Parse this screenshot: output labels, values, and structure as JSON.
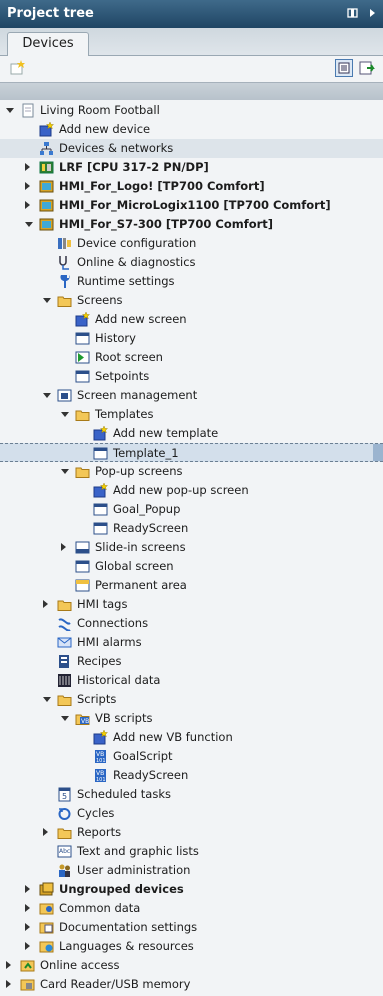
{
  "header": {
    "title": "Project tree"
  },
  "tabs": [
    {
      "label": "Devices"
    }
  ],
  "icons": {
    "pin": "pin-icon",
    "close": "close-arrow-icon",
    "new_group": "new-group-icon",
    "detail_view": "detail-view-icon",
    "export": "export-icon"
  },
  "tree": [
    {
      "label": "Living Room Football",
      "level": 0,
      "expander": "open",
      "icon": "project-icon"
    },
    {
      "label": "Add new device",
      "level": 1,
      "expander": "none",
      "icon": "add-device-icon"
    },
    {
      "label": "Devices & networks",
      "level": 1,
      "expander": "none",
      "icon": "network-icon",
      "highlight": true
    },
    {
      "label": "LRF [CPU 317-2 PN/DP]",
      "level": 1,
      "expander": "closed",
      "icon": "plc-icon",
      "bold": true
    },
    {
      "label": "HMI_For_Logo! [TP700 Comfort]",
      "level": 1,
      "expander": "closed",
      "icon": "hmi-device-icon",
      "bold": true
    },
    {
      "label": "HMI_For_MicroLogix1100 [TP700 Comfort]",
      "level": 1,
      "expander": "closed",
      "icon": "hmi-device-icon",
      "bold": true
    },
    {
      "label": "HMI_For_S7-300 [TP700 Comfort]",
      "level": 1,
      "expander": "open",
      "icon": "hmi-device-icon",
      "bold": true
    },
    {
      "label": "Device configuration",
      "level": 2,
      "expander": "none",
      "icon": "device-config-icon"
    },
    {
      "label": "Online & diagnostics",
      "level": 2,
      "expander": "none",
      "icon": "diagnostics-icon"
    },
    {
      "label": "Runtime settings",
      "level": 2,
      "expander": "none",
      "icon": "wrench-icon"
    },
    {
      "label": "Screens",
      "level": 2,
      "expander": "open",
      "icon": "folder-icon"
    },
    {
      "label": "Add new screen",
      "level": 3,
      "expander": "none",
      "icon": "add-screen-icon"
    },
    {
      "label": "History",
      "level": 3,
      "expander": "none",
      "icon": "screen-icon"
    },
    {
      "label": "Root screen",
      "level": 3,
      "expander": "none",
      "icon": "root-screen-icon"
    },
    {
      "label": "Setpoints",
      "level": 3,
      "expander": "none",
      "icon": "screen-icon"
    },
    {
      "label": "Screen management",
      "level": 2,
      "expander": "open",
      "icon": "screen-management-icon"
    },
    {
      "label": "Templates",
      "level": 3,
      "expander": "open",
      "icon": "template-folder-icon"
    },
    {
      "label": "Add new template",
      "level": 4,
      "expander": "none",
      "icon": "add-screen-icon"
    },
    {
      "label": "Template_1",
      "level": 4,
      "expander": "none",
      "icon": "screen-icon",
      "selected": true
    },
    {
      "label": "Pop-up screens",
      "level": 3,
      "expander": "open",
      "icon": "folder-icon"
    },
    {
      "label": "Add new pop-up screen",
      "level": 4,
      "expander": "none",
      "icon": "add-screen-icon"
    },
    {
      "label": "Goal_Popup",
      "level": 4,
      "expander": "none",
      "icon": "screen-icon"
    },
    {
      "label": "ReadyScreen",
      "level": 4,
      "expander": "none",
      "icon": "screen-icon"
    },
    {
      "label": "Slide-in screens",
      "level": 3,
      "expander": "closed",
      "icon": "slide-in-icon"
    },
    {
      "label": "Global screen",
      "level": 3,
      "expander": "none",
      "icon": "global-screen-icon"
    },
    {
      "label": "Permanent area",
      "level": 3,
      "expander": "none",
      "icon": "permanent-area-icon"
    },
    {
      "label": "HMI tags",
      "level": 2,
      "expander": "closed",
      "icon": "tags-folder-icon"
    },
    {
      "label": "Connections",
      "level": 2,
      "expander": "none",
      "icon": "connections-icon"
    },
    {
      "label": "HMI alarms",
      "level": 2,
      "expander": "none",
      "icon": "alarms-icon"
    },
    {
      "label": "Recipes",
      "level": 2,
      "expander": "none",
      "icon": "recipes-icon"
    },
    {
      "label": "Historical data",
      "level": 2,
      "expander": "none",
      "icon": "historical-data-icon"
    },
    {
      "label": "Scripts",
      "level": 2,
      "expander": "open",
      "icon": "scripts-folder-icon"
    },
    {
      "label": "VB scripts",
      "level": 3,
      "expander": "open",
      "icon": "vb-folder-icon"
    },
    {
      "label": "Add new VB function",
      "level": 4,
      "expander": "none",
      "icon": "add-screen-icon"
    },
    {
      "label": "GoalScript",
      "level": 4,
      "expander": "none",
      "icon": "vb-script-icon"
    },
    {
      "label": "ReadyScreen",
      "level": 4,
      "expander": "none",
      "icon": "vb-script-icon"
    },
    {
      "label": "Scheduled tasks",
      "level": 2,
      "expander": "none",
      "icon": "calendar-icon"
    },
    {
      "label": "Cycles",
      "level": 2,
      "expander": "none",
      "icon": "cycles-icon"
    },
    {
      "label": "Reports",
      "level": 2,
      "expander": "closed",
      "icon": "reports-icon"
    },
    {
      "label": "Text and graphic lists",
      "level": 2,
      "expander": "none",
      "icon": "text-lists-icon"
    },
    {
      "label": "User administration",
      "level": 2,
      "expander": "none",
      "icon": "users-icon"
    },
    {
      "label": "Ungrouped devices",
      "level": 1,
      "expander": "closed",
      "icon": "ungrouped-devices-icon",
      "bold": true
    },
    {
      "label": "Common data",
      "level": 1,
      "expander": "closed",
      "icon": "common-data-icon"
    },
    {
      "label": "Documentation settings",
      "level": 1,
      "expander": "closed",
      "icon": "documentation-icon"
    },
    {
      "label": "Languages & resources",
      "level": 1,
      "expander": "closed",
      "icon": "languages-icon"
    },
    {
      "label": "Online access",
      "level": 0,
      "expander": "closed",
      "icon": "online-access-icon"
    },
    {
      "label": "Card Reader/USB memory",
      "level": 0,
      "expander": "closed",
      "icon": "card-reader-icon"
    }
  ]
}
